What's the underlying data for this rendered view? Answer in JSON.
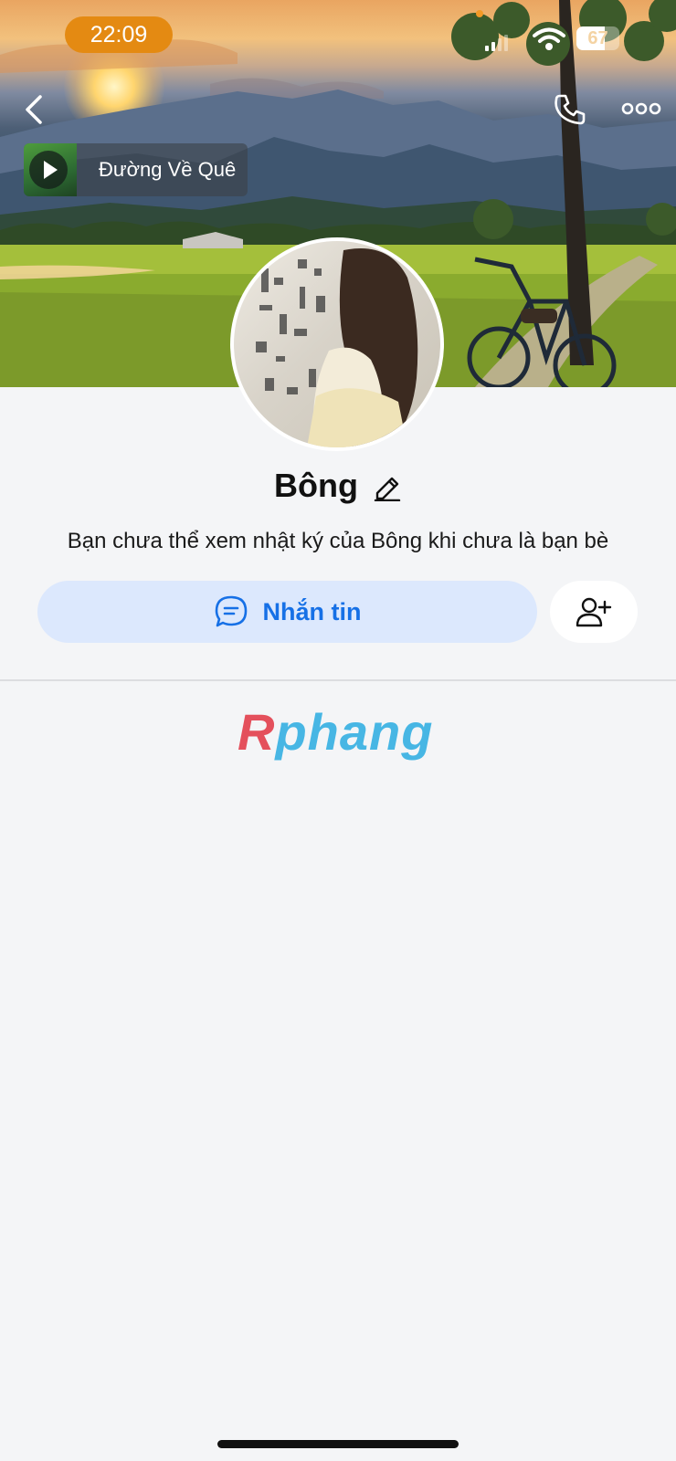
{
  "status_bar": {
    "time": "22:09",
    "battery_text": "67",
    "battery_level": 0.67,
    "time_pill_color": "#e48a12"
  },
  "nav": {
    "back_icon": "chevron-left-icon",
    "call_icon": "phone-icon",
    "more_icon": "ellipsis-icon"
  },
  "music": {
    "title": "Đường Về Quê",
    "play_icon": "play-icon"
  },
  "profile": {
    "name": "Bông",
    "edit_icon": "pencil-icon",
    "diary_note": "Bạn chưa thể xem nhật ký của Bông khi chưa là bạn bè"
  },
  "actions": {
    "message_label": "Nhắn tin",
    "message_icon": "chat-bubble-icon",
    "add_friend_icon": "add-friend-icon",
    "accent_color": "#1670e6"
  },
  "watermark": {
    "first": "R",
    "rest": "phang"
  }
}
